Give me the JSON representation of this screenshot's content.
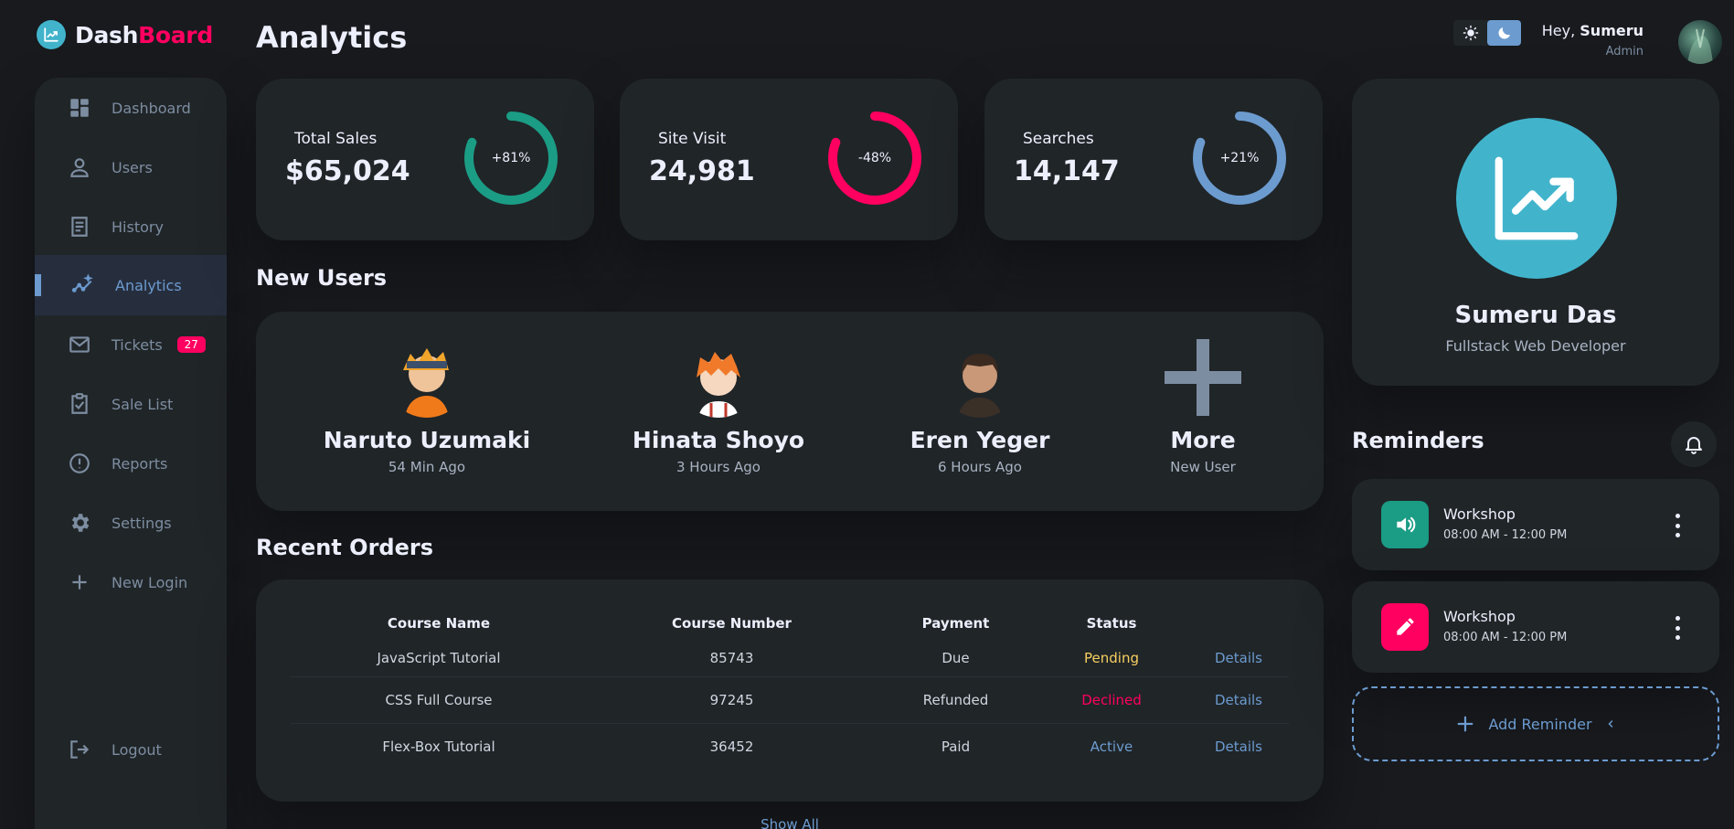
{
  "logo": {
    "part1": "Dash",
    "part2": "Board"
  },
  "sidebar": {
    "items": [
      {
        "label": "Dashboard",
        "icon": "grid-icon"
      },
      {
        "label": "Users",
        "icon": "user-icon"
      },
      {
        "label": "History",
        "icon": "receipt-icon"
      },
      {
        "label": "Analytics",
        "icon": "insights-icon"
      },
      {
        "label": "Tickets",
        "icon": "mail-icon",
        "badge": "27"
      },
      {
        "label": "Sale List",
        "icon": "clipboard-check-icon"
      },
      {
        "label": "Reports",
        "icon": "alert-icon"
      },
      {
        "label": "Settings",
        "icon": "gear-icon"
      },
      {
        "label": "New Login",
        "icon": "plus-icon"
      }
    ],
    "logout": "Logout"
  },
  "page_title": "Analytics",
  "stats": [
    {
      "label": "Total Sales",
      "value": "$65,024",
      "percent": "+81%",
      "progress": 0.81,
      "color": "#1b9c85"
    },
    {
      "label": "Site Visit",
      "value": "24,981",
      "percent": "-48%",
      "progress": 0.81,
      "color": "#ff0060"
    },
    {
      "label": "Searches",
      "value": "14,147",
      "percent": "+21%",
      "progress": 0.81,
      "color": "#6c9bcf"
    }
  ],
  "new_users": {
    "title": "New Users",
    "users": [
      {
        "name": "Naruto Uzumaki",
        "time": "54 Min Ago"
      },
      {
        "name": "Hinata Shoyo",
        "time": "3 Hours Ago"
      },
      {
        "name": "Eren Yeger",
        "time": "6 Hours Ago"
      },
      {
        "name": "More",
        "time": "New User"
      }
    ]
  },
  "orders": {
    "title": "Recent Orders",
    "headers": [
      "Course Name",
      "Course Number",
      "Payment",
      "Status",
      ""
    ],
    "rows": [
      {
        "name": "JavaScript Tutorial",
        "number": "85743",
        "payment": "Due",
        "status": "Pending",
        "action": "Details"
      },
      {
        "name": "CSS Full Course",
        "number": "97245",
        "payment": "Refunded",
        "status": "Declined",
        "action": "Details"
      },
      {
        "name": "Flex-Box Tutorial",
        "number": "36452",
        "payment": "Paid",
        "status": "Active",
        "action": "Details"
      }
    ],
    "show_all": "Show All"
  },
  "header": {
    "greeting": "Hey,",
    "username": "Sumeru",
    "role": "Admin"
  },
  "profile": {
    "name": "Sumeru Das",
    "role": "Fullstack Web Developer"
  },
  "reminders": {
    "title": "Reminders",
    "items": [
      {
        "name": "Workshop",
        "time": "08:00 AM - 12:00 PM",
        "icon": "volume-icon",
        "color": "#1b9c85"
      },
      {
        "name": "Workshop",
        "time": "08:00 AM - 12:00 PM",
        "icon": "edit-icon",
        "color": "#ff0060"
      }
    ],
    "add_label": "Add Reminder"
  },
  "colors": {
    "background": "#181a1e",
    "card": "#202528",
    "primary": "#6c9bcf",
    "danger": "#ff0060",
    "success": "#1b9c85",
    "warning": "#f7d060"
  }
}
